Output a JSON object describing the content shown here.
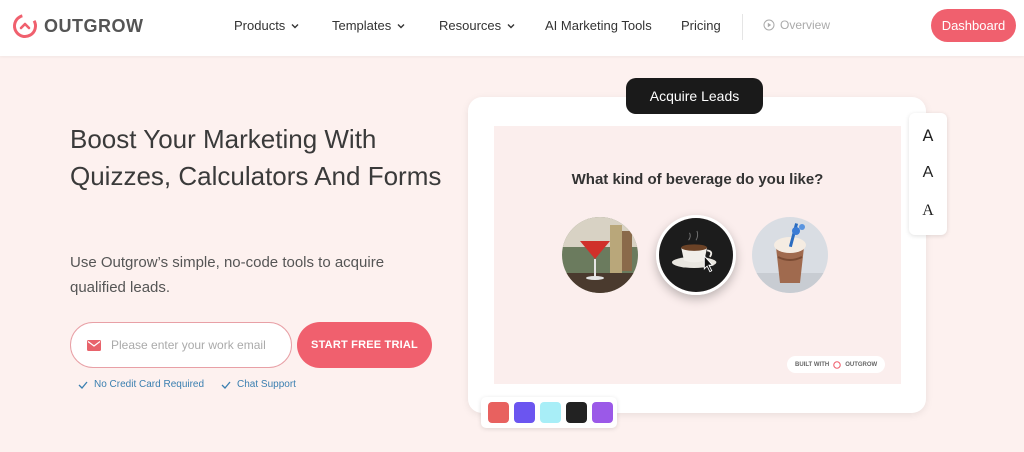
{
  "brand": {
    "name": "OUTGROW",
    "accent": "#f0606e"
  },
  "nav": {
    "items": [
      {
        "label": "Products",
        "dropdown": true
      },
      {
        "label": "Templates",
        "dropdown": true
      },
      {
        "label": "Resources",
        "dropdown": true
      },
      {
        "label": "AI Marketing Tools",
        "dropdown": false
      },
      {
        "label": "Pricing",
        "dropdown": false
      }
    ],
    "overview_label": "Overview",
    "dashboard_label": "Dashboard"
  },
  "hero": {
    "title": "Boost Your Marketing With Quizzes, Calculators And Forms",
    "subtitle": "Use Outgrow’s simple, no-code tools to acquire qualified leads.",
    "email_placeholder": "Please enter your work email",
    "cta_label": "START FREE TRIAL",
    "checks": [
      "No Credit Card Required",
      "Chat Support"
    ]
  },
  "demo": {
    "badge": "Acquire Leads",
    "question": "What kind of beverage do you like?",
    "options": [
      {
        "icon": "cocktail-icon"
      },
      {
        "icon": "coffee-cup-icon",
        "selected": true
      },
      {
        "icon": "milkshake-icon"
      }
    ],
    "built_with": "BUILT WITH",
    "built_with_brand": "OUTGROW",
    "font_options": [
      "A",
      "A",
      "A"
    ],
    "swatches": [
      "#e8615f",
      "#6b55f0",
      "#a8eef7",
      "#222222",
      "#9b59e8"
    ]
  }
}
